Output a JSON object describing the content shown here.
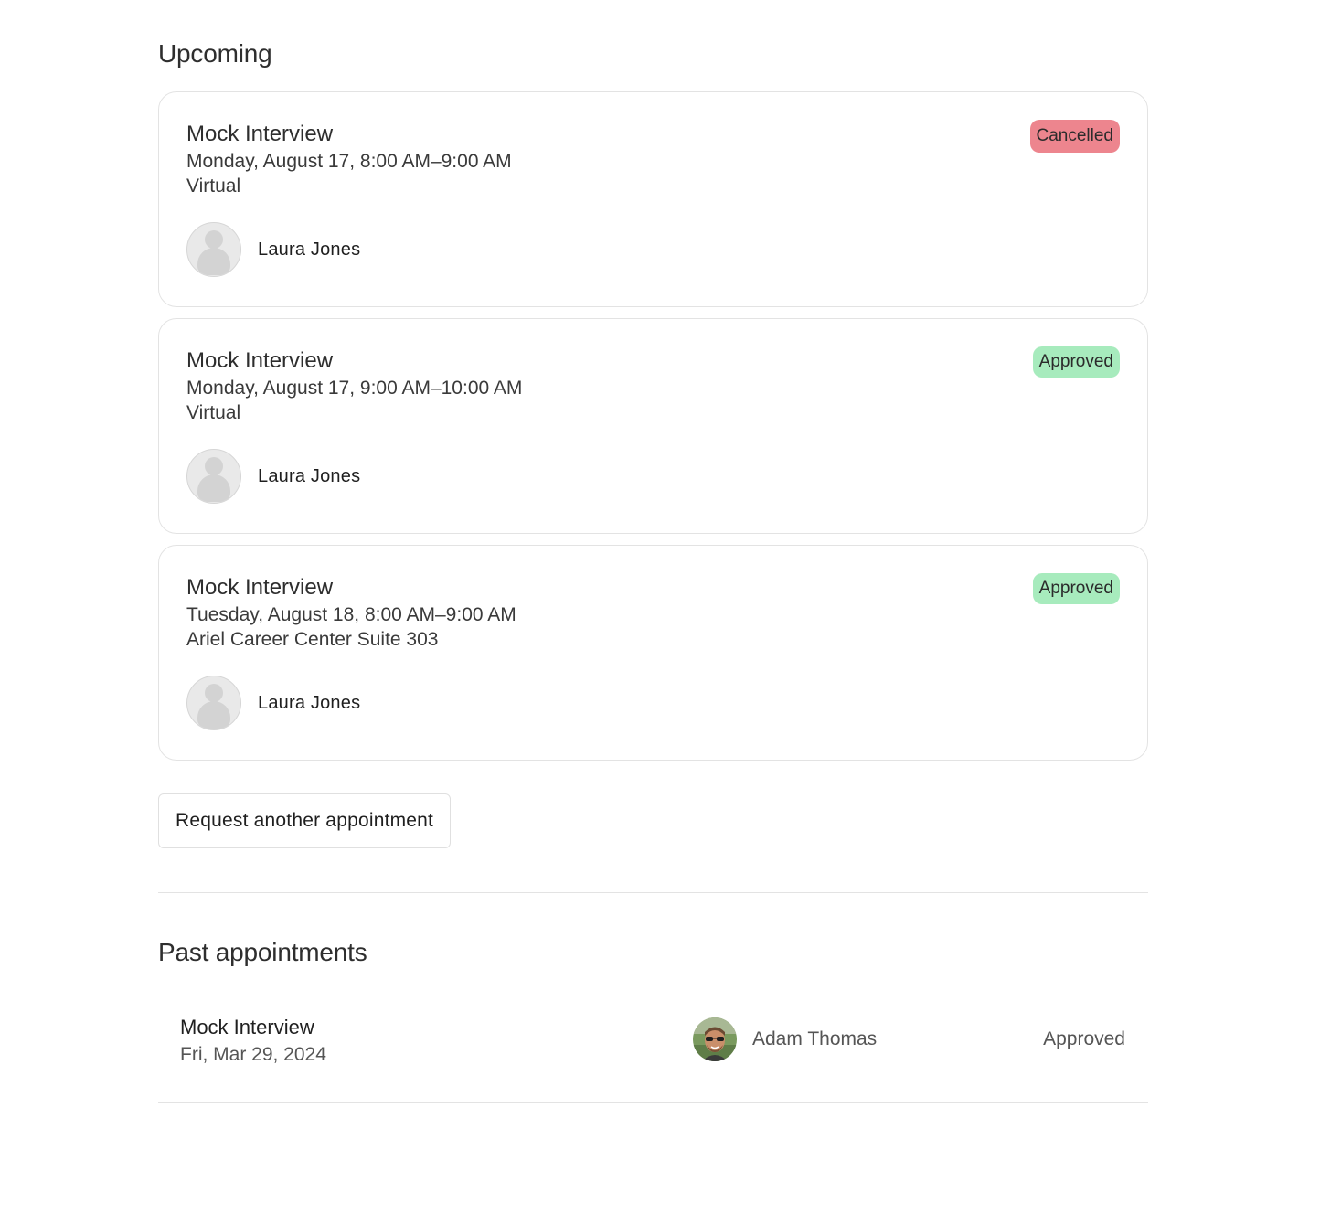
{
  "upcoming": {
    "title": "Upcoming",
    "appointments": [
      {
        "title": "Mock Interview",
        "datetime": "Monday, August 17, 8:00 AM–9:00 AM",
        "location": "Virtual",
        "status": "Cancelled",
        "person": "Laura Jones"
      },
      {
        "title": "Mock Interview",
        "datetime": "Monday, August 17, 9:00 AM–10:00 AM",
        "location": "Virtual",
        "status": "Approved",
        "person": "Laura Jones"
      },
      {
        "title": "Mock Interview",
        "datetime": "Tuesday, August 18, 8:00 AM–9:00 AM",
        "location": "Ariel Career Center Suite 303",
        "status": "Approved",
        "person": "Laura Jones"
      }
    ],
    "request_button": "Request another appointment"
  },
  "past": {
    "title": "Past appointments",
    "appointments": [
      {
        "title": "Mock Interview",
        "date": "Fri, Mar 29, 2024",
        "person": "Adam Thomas",
        "status": "Approved"
      }
    ]
  },
  "colors": {
    "cancelled_badge": "#ed858e",
    "approved_badge": "#a7ebbd",
    "border": "#e3e3e3"
  }
}
